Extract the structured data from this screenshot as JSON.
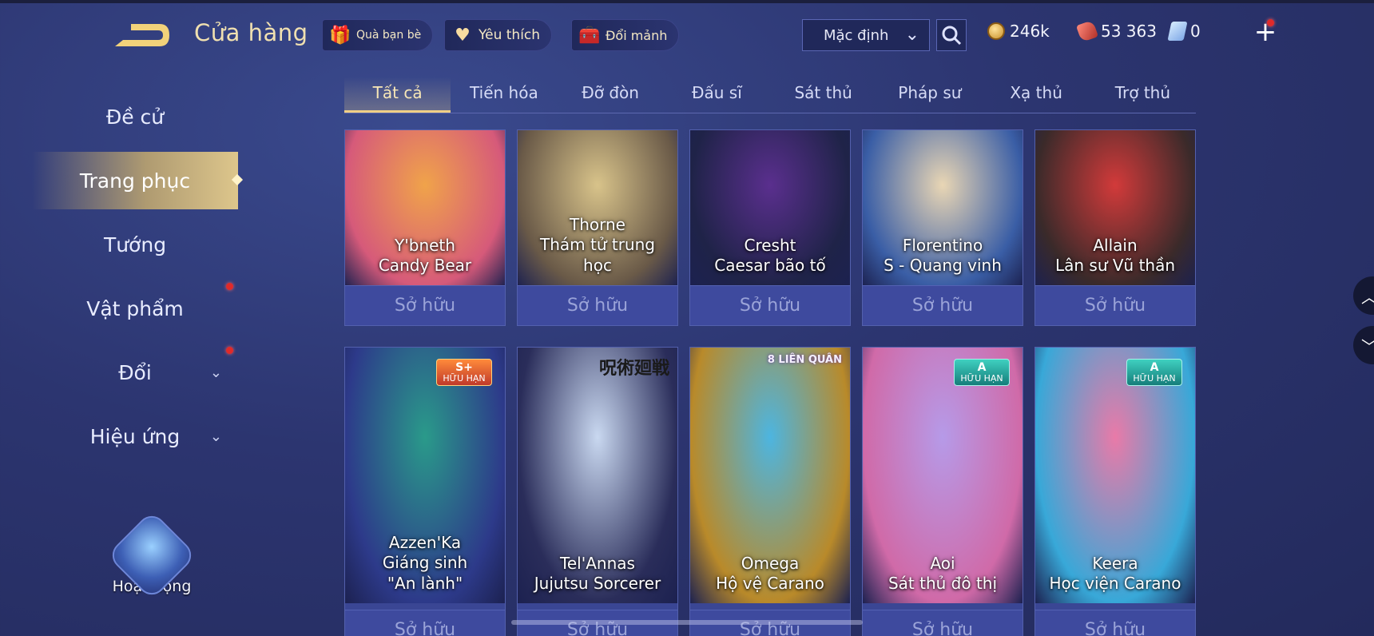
{
  "header": {
    "title": "Cửa hàng",
    "pills": [
      {
        "label": "Quà bạn bè",
        "icon": "gift-icon"
      },
      {
        "label": "Yêu thích",
        "icon": "heart-icon"
      },
      {
        "label": "Đổi mảnh",
        "icon": "chest-icon"
      }
    ],
    "sort": {
      "value": "Mặc định"
    },
    "currencies": {
      "gold": "246k",
      "gems": "53 363",
      "vouchers": "0"
    }
  },
  "sidebar": {
    "items": [
      {
        "label": "Đề cử"
      },
      {
        "label": "Trang phục"
      },
      {
        "label": "Tướng"
      },
      {
        "label": "Vật phẩm"
      },
      {
        "label": "Đổi"
      },
      {
        "label": "Hiệu ứng"
      }
    ],
    "activity_label": "Hoạt động"
  },
  "tabs": [
    "Tất cả",
    "Tiến hóa",
    "Đỡ đòn",
    "Đấu sĩ",
    "Sát thủ",
    "Pháp sư",
    "Xạ thủ",
    "Trợ thủ"
  ],
  "cards": [
    {
      "hero": "Y'bneth",
      "skin": "Candy Bear",
      "status": "Sở hữu",
      "c1": "#f0a34a",
      "c2": "#d65a7a"
    },
    {
      "hero": "Thorne",
      "skin": "Thám tử trung học",
      "status": "Sở hữu",
      "c1": "#d8c38a",
      "c2": "#6a5a48"
    },
    {
      "hero": "Cresht",
      "skin": "Caesar bão tố",
      "status": "Sở hữu",
      "c1": "#5a2f8e",
      "c2": "#1f2348"
    },
    {
      "hero": "Florentino",
      "skin": "S - Quang vinh",
      "status": "Sở hữu",
      "c1": "#e9d6b4",
      "c2": "#3a5ea6"
    },
    {
      "hero": "Allain",
      "skin": "Lân sư Vũ thần",
      "status": "Sở hữu",
      "c1": "#d23a3a",
      "c2": "#3a2a2a"
    },
    {
      "hero": "Azzen'Ka",
      "skin": "Giáng sinh \"An lành\"",
      "status": "Sở hữu",
      "badge": "S+",
      "badge_sub": "HỮU HẠN",
      "c1": "#2a9a8a",
      "c2": "#2d3a8a"
    },
    {
      "hero": "Tel'Annas",
      "skin": "Jujutsu Sorcerer",
      "status": "Sở hữu",
      "logo": "呪術廻戦",
      "c1": "#c9d8f0",
      "c2": "#2a2d5a"
    },
    {
      "hero": "Omega",
      "skin": "Hộ vệ Carano",
      "status": "Sở hữu",
      "logo": "8 LIÊN QUÂN",
      "c1": "#4db5e0",
      "c2": "#b98a2a"
    },
    {
      "hero": "Aoi",
      "skin": "Sát thủ đô thị",
      "status": "Sở hữu",
      "badge": "A",
      "badge_sub": "HỮU HẠN",
      "c1": "#b69ae8",
      "c2": "#d06aa8"
    },
    {
      "hero": "Keera",
      "skin": "Học viện Carano",
      "status": "Sở hữu",
      "badge": "A",
      "badge_sub": "HỮU HẠN",
      "c1": "#e97aa8",
      "c2": "#38a8d8"
    }
  ]
}
